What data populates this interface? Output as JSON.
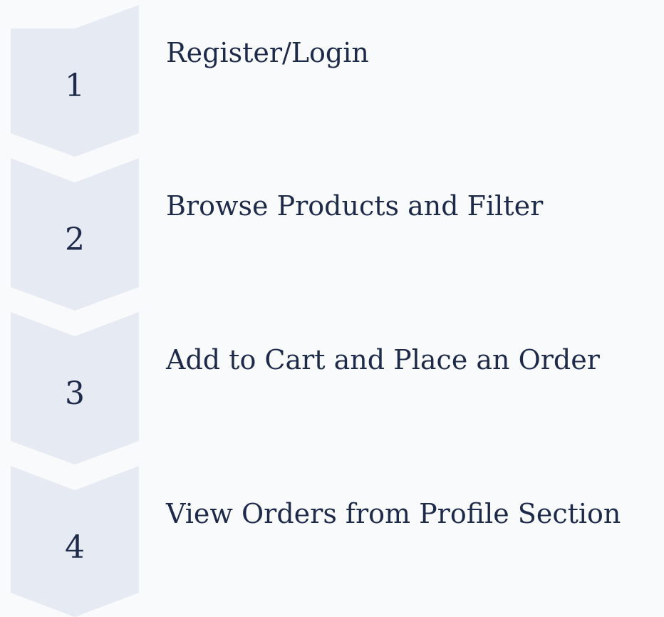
{
  "colors": {
    "background": "#f8fafc",
    "chevron_fill": "#e6eaf2",
    "text": "#1e2a4a"
  },
  "steps": [
    {
      "number": "1",
      "label": "Register/Login"
    },
    {
      "number": "2",
      "label": "Browse Products and Filter"
    },
    {
      "number": "3",
      "label": "Add to Cart and Place an Order"
    },
    {
      "number": "4",
      "label": "View Orders from Profile Section"
    }
  ]
}
